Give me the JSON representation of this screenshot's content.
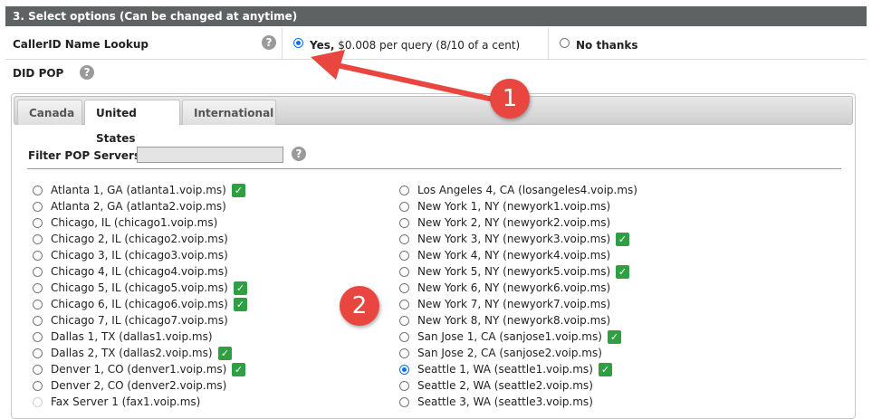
{
  "section": {
    "title": "3. Select options (Can be changed at anytime)"
  },
  "callerid": {
    "label": "CallerID Name Lookup",
    "yes_bold": "Yes,",
    "yes_rest": " $0.008 per query (8/10 of a cent)",
    "no_label": "No thanks"
  },
  "did_pop": {
    "label": "DID POP"
  },
  "tabs": [
    {
      "label": "Canada"
    },
    {
      "label": "United States"
    },
    {
      "label": "International"
    }
  ],
  "filter": {
    "label": "Filter POP Servers:",
    "value": ""
  },
  "help_glyph": "?",
  "check_glyph": "✓",
  "badges": [
    "1",
    "2"
  ],
  "servers_left": [
    {
      "label": "Atlanta 1, GA (atlanta1.voip.ms)",
      "check": true,
      "selected": false,
      "disabled": false
    },
    {
      "label": "Atlanta 2, GA (atlanta2.voip.ms)",
      "check": false,
      "selected": false,
      "disabled": false
    },
    {
      "label": "Chicago, IL (chicago1.voip.ms)",
      "check": false,
      "selected": false,
      "disabled": false
    },
    {
      "label": "Chicago 2, IL (chicago2.voip.ms)",
      "check": false,
      "selected": false,
      "disabled": false
    },
    {
      "label": "Chicago 3, IL (chicago3.voip.ms)",
      "check": false,
      "selected": false,
      "disabled": false
    },
    {
      "label": "Chicago 4, IL (chicago4.voip.ms)",
      "check": false,
      "selected": false,
      "disabled": false
    },
    {
      "label": "Chicago 5, IL (chicago5.voip.ms)",
      "check": true,
      "selected": false,
      "disabled": false
    },
    {
      "label": "Chicago 6, IL (chicago6.voip.ms)",
      "check": true,
      "selected": false,
      "disabled": false
    },
    {
      "label": "Chicago 7, IL (chicago7.voip.ms)",
      "check": false,
      "selected": false,
      "disabled": false
    },
    {
      "label": "Dallas 1, TX (dallas1.voip.ms)",
      "check": false,
      "selected": false,
      "disabled": false
    },
    {
      "label": "Dallas 2, TX (dallas2.voip.ms)",
      "check": true,
      "selected": false,
      "disabled": false
    },
    {
      "label": "Denver 1, CO (denver1.voip.ms)",
      "check": true,
      "selected": false,
      "disabled": false
    },
    {
      "label": "Denver 2, CO (denver2.voip.ms)",
      "check": false,
      "selected": false,
      "disabled": false
    },
    {
      "label": "Fax Server 1 (fax1.voip.ms)",
      "check": false,
      "selected": false,
      "disabled": true
    }
  ],
  "servers_right": [
    {
      "label": "Los Angeles 4, CA (losangeles4.voip.ms)",
      "check": false,
      "selected": false,
      "disabled": false
    },
    {
      "label": "New York 1, NY (newyork1.voip.ms)",
      "check": false,
      "selected": false,
      "disabled": false
    },
    {
      "label": "New York 2, NY (newyork2.voip.ms)",
      "check": false,
      "selected": false,
      "disabled": false
    },
    {
      "label": "New York 3, NY (newyork3.voip.ms)",
      "check": true,
      "selected": false,
      "disabled": false
    },
    {
      "label": "New York 4, NY (newyork4.voip.ms)",
      "check": false,
      "selected": false,
      "disabled": false
    },
    {
      "label": "New York 5, NY (newyork5.voip.ms)",
      "check": true,
      "selected": false,
      "disabled": false
    },
    {
      "label": "New York 6, NY (newyork6.voip.ms)",
      "check": false,
      "selected": false,
      "disabled": false
    },
    {
      "label": "New York 7, NY (newyork7.voip.ms)",
      "check": false,
      "selected": false,
      "disabled": false
    },
    {
      "label": "New York 8, NY (newyork8.voip.ms)",
      "check": false,
      "selected": false,
      "disabled": false
    },
    {
      "label": "San Jose 1, CA (sanjose1.voip.ms)",
      "check": true,
      "selected": false,
      "disabled": false
    },
    {
      "label": "San Jose 2, CA (sanjose2.voip.ms)",
      "check": false,
      "selected": false,
      "disabled": false
    },
    {
      "label": "Seattle 1, WA (seattle1.voip.ms)",
      "check": true,
      "selected": true,
      "disabled": false
    },
    {
      "label": "Seattle 2, WA (seattle2.voip.ms)",
      "check": false,
      "selected": false,
      "disabled": false
    },
    {
      "label": "Seattle 3, WA (seattle3.voip.ms)",
      "check": false,
      "selected": false,
      "disabled": false
    }
  ],
  "colors": {
    "header_bg": "#5f6262",
    "annotation_red": "#e8463f",
    "check_green": "#2ea043",
    "radio_blue": "#0a6cff"
  }
}
